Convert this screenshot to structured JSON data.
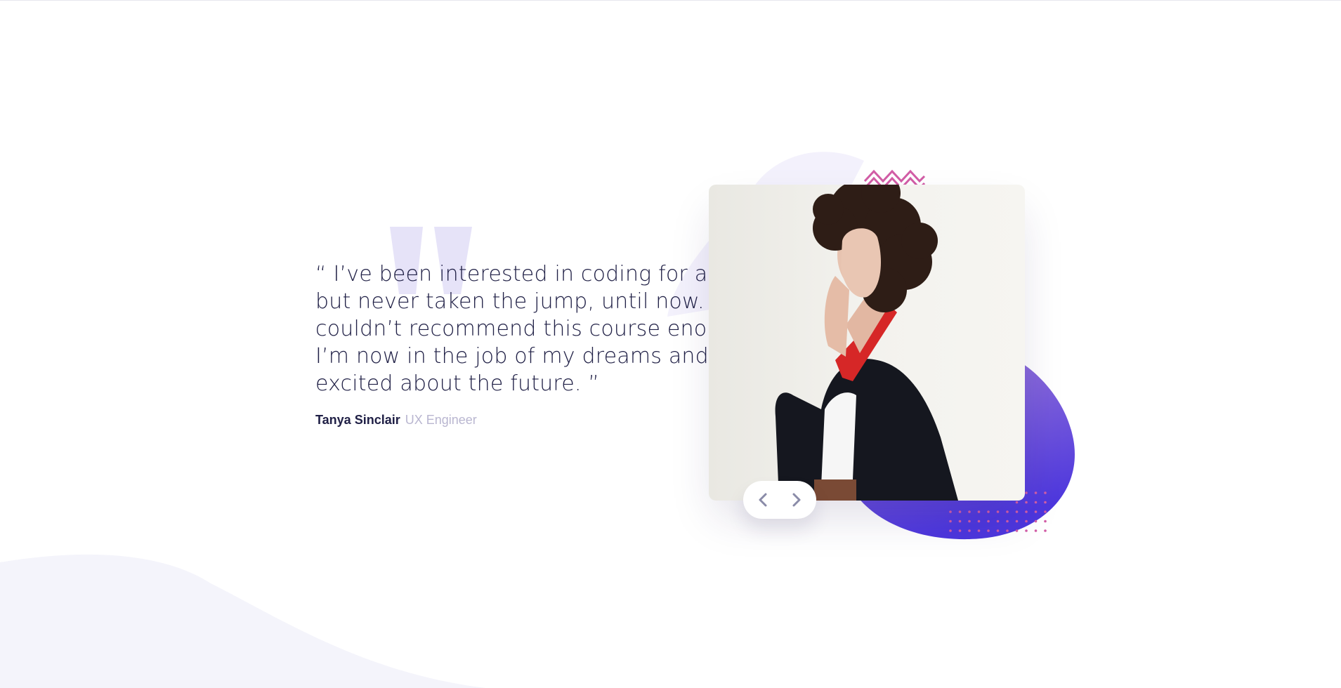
{
  "testimonial": {
    "quote": "“ I’ve been interested in coding for a while but never taken the jump, until now. I couldn’t recommend this course enough. I’m now in the job of my dreams and so excited about the future. ”",
    "author_name": "Tanya Sinclair",
    "author_role": "UX Engineer"
  },
  "photo": {
    "alt": "Tanya Sinclair"
  },
  "controls": {
    "prev_icon": "chevron-left-icon",
    "next_icon": "chevron-right-icon"
  },
  "colors": {
    "text_dark": "#202046",
    "text_muted": "#b9b6d0",
    "quote_mark": "#e6e3f8",
    "blob_start": "#9d7ad6",
    "blob_end": "#4e37dd",
    "accent_pink": "#d25da6",
    "bg_curve": "#f4f4fb"
  }
}
